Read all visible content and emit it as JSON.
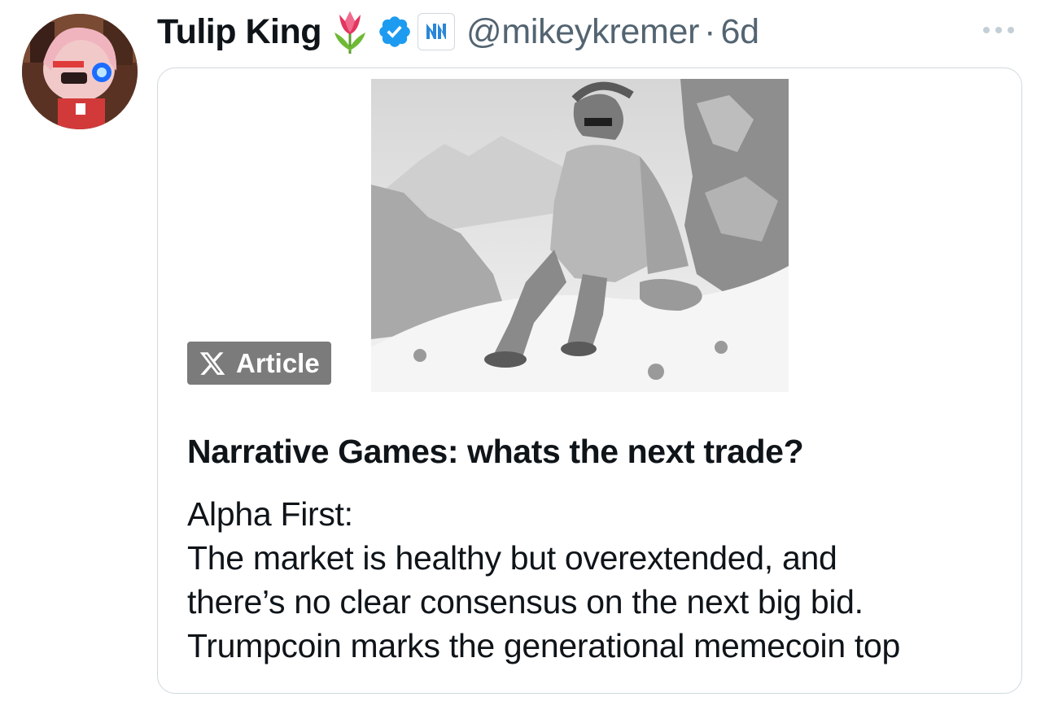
{
  "author": {
    "display_name": "Tulip King",
    "handle": "@mikeykremer",
    "separator": "·",
    "time_ago": "6d",
    "name_emoji_icon": "tulip-icon",
    "verified_icon": "verified-badge-icon",
    "affiliate_icon": "affiliate-badge-icon",
    "avatar": "user-avatar"
  },
  "card": {
    "badge_label": "Article",
    "badge_icon": "x-logo-icon",
    "title": "Narrative Games: whats the next trade?",
    "body_lines": [
      "Alpha First:",
      "The market is healthy but overextended, and",
      "there’s no clear consensus on the next big bid.",
      "Trumpcoin marks the generational memecoin top"
    ],
    "media": "article-cover-image"
  },
  "colors": {
    "text_primary": "#0f1419",
    "text_secondary": "#536471",
    "verified_blue": "#1d9bf0",
    "border": "#cfd9de",
    "badge_bg": "#7b7b7b"
  }
}
